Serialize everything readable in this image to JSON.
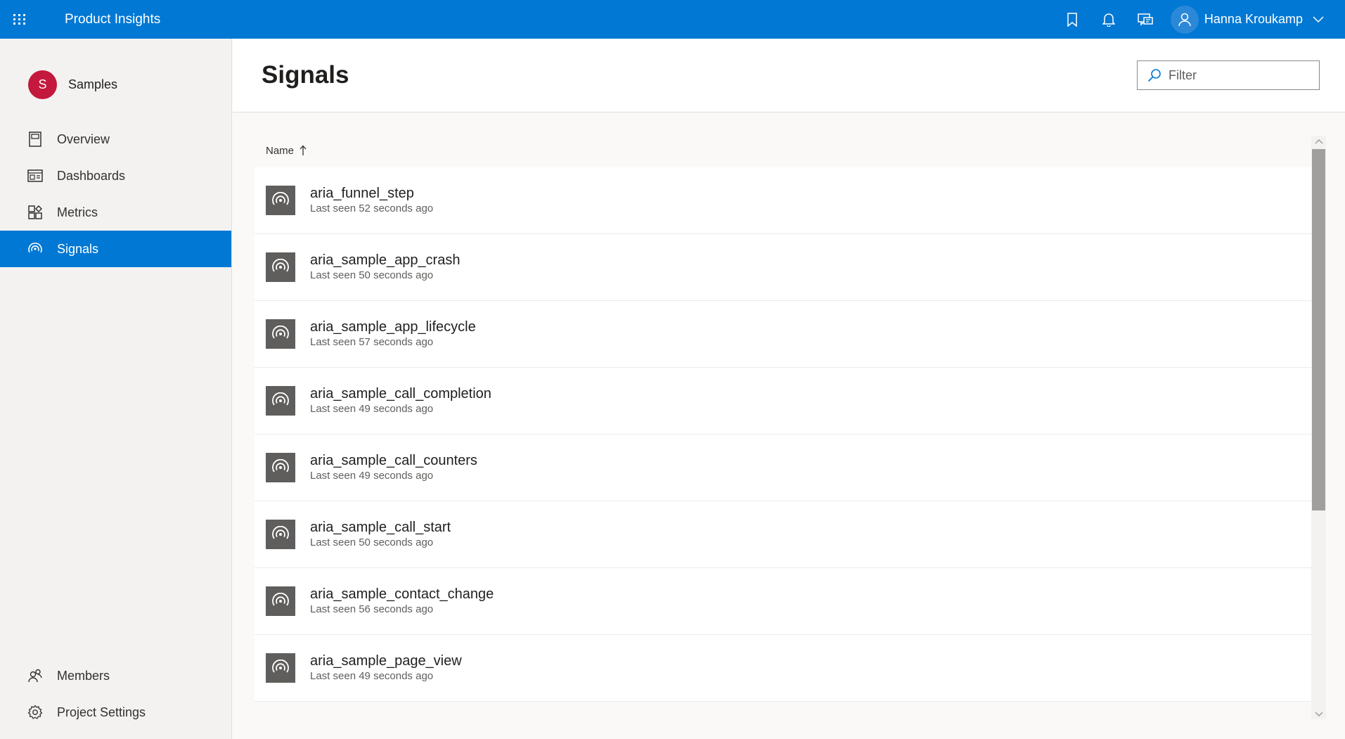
{
  "topbar": {
    "app_title": "Product Insights",
    "icons": [
      "waffle-icon",
      "bookmark-icon",
      "bell-icon",
      "feedback-icon",
      "person-icon",
      "chevron-down-icon"
    ],
    "user_name": "Hanna Kroukamp"
  },
  "sidebar": {
    "project": {
      "initial": "S",
      "name": "Samples",
      "color": "#c4183c"
    },
    "items": [
      {
        "label": "Overview",
        "icon": "overview-icon"
      },
      {
        "label": "Dashboards",
        "icon": "dashboards-icon"
      },
      {
        "label": "Metrics",
        "icon": "metrics-icon"
      },
      {
        "label": "Signals",
        "icon": "signal-icon",
        "active": true
      }
    ],
    "bottom_items": [
      {
        "label": "Members",
        "icon": "members-icon"
      },
      {
        "label": "Project Settings",
        "icon": "gear-icon"
      }
    ]
  },
  "main": {
    "title": "Signals",
    "filter_placeholder": "Filter",
    "column_header": "Name",
    "sort_direction": "ascending",
    "rows": [
      {
        "name": "aria_funnel_step",
        "last_seen": "Last seen 52 seconds ago"
      },
      {
        "name": "aria_sample_app_crash",
        "last_seen": "Last seen 50 seconds ago"
      },
      {
        "name": "aria_sample_app_lifecycle",
        "last_seen": "Last seen 57 seconds ago"
      },
      {
        "name": "aria_sample_call_completion",
        "last_seen": "Last seen 49 seconds ago"
      },
      {
        "name": "aria_sample_call_counters",
        "last_seen": "Last seen 49 seconds ago"
      },
      {
        "name": "aria_sample_call_start",
        "last_seen": "Last seen 50 seconds ago"
      },
      {
        "name": "aria_sample_contact_change",
        "last_seen": "Last seen 56 seconds ago"
      },
      {
        "name": "aria_sample_page_view",
        "last_seen": "Last seen 49 seconds ago"
      }
    ]
  },
  "colors": {
    "accent": "#0078d4",
    "row_icon_bg": "#605e5c"
  }
}
